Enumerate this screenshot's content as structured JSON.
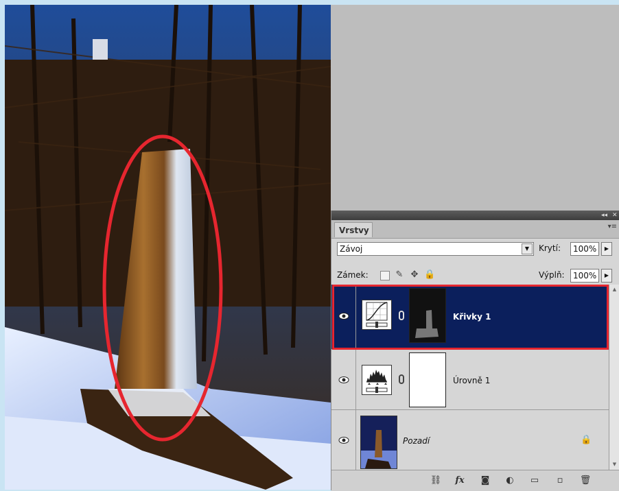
{
  "panel": {
    "tab_label": "Vrstvy",
    "menu_icon": "panel-menu-icon",
    "blend_mode": "Závoj",
    "opacity_label": "Krytí:",
    "opacity_value": "100%",
    "lock_label": "Zámek:",
    "fill_label": "Výplň:",
    "fill_value": "100%"
  },
  "layers": [
    {
      "name": "Křivky 1",
      "type": "curves-adjustment",
      "selected": true,
      "visible": true
    },
    {
      "name": "Úrovně 1",
      "type": "levels-adjustment",
      "selected": false,
      "visible": true
    },
    {
      "name": "Pozadí",
      "type": "background-image",
      "selected": false,
      "visible": true,
      "locked": true
    }
  ],
  "bottom_icons": [
    "link-layers-icon",
    "fx-icon",
    "add-mask-icon",
    "new-adjustment-icon",
    "new-group-icon",
    "new-layer-icon",
    "trash-icon"
  ],
  "colors": {
    "selected_row": "#0b1f5c",
    "highlight": "#e6262f",
    "panel_bg": "#d6d6d6"
  }
}
